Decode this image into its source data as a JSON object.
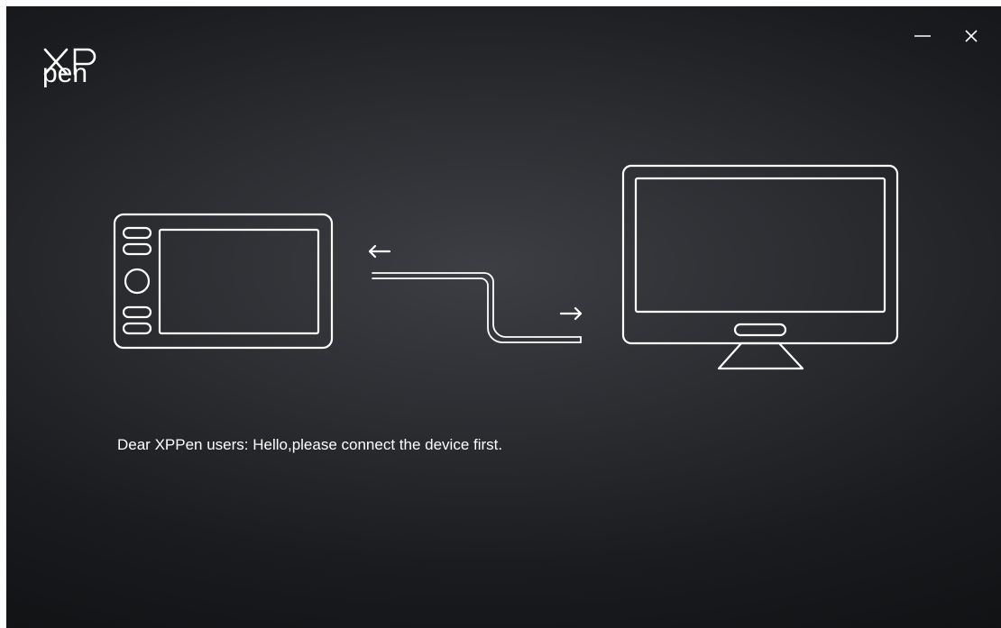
{
  "window": {
    "logo_top": "XP",
    "logo_bottom": "pen",
    "controls": [
      {
        "name": "minimize-button",
        "icon": "minimize-icon"
      },
      {
        "name": "close-button",
        "icon": "close-icon"
      }
    ]
  },
  "illustration": {
    "left_device": "pen-display-tablet-icon",
    "cable": "usb-cable-icon",
    "right_device": "computer-monitor-icon",
    "arrows": [
      "arrow-left-icon",
      "arrow-right-icon"
    ]
  },
  "message": {
    "text": "Dear XPPen users: Hello,please connect the device first."
  },
  "colors": {
    "background": "#2b2c30",
    "foreground": "#ffffff"
  }
}
